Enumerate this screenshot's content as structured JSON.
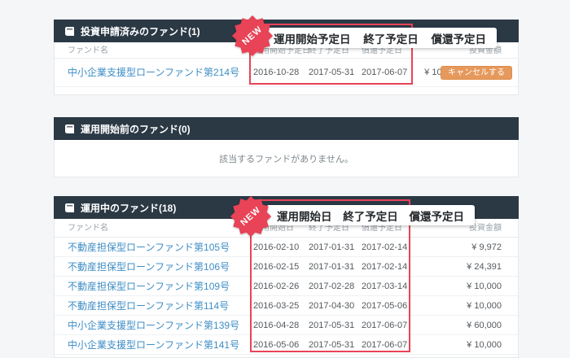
{
  "badge_label": "NEW",
  "colors": {
    "accent_red": "#e84356",
    "header_dark": "#2b3945",
    "link_blue": "#3e8dc5",
    "button_orange": "#e6995c",
    "page_background": "#f4f6f7"
  },
  "panel_applied": {
    "title": "投資申請済みのファンド(1)",
    "callout": {
      "c1": "運用開始予定日",
      "c2": "終了予定日",
      "c3": "償還予定日"
    },
    "columns": {
      "name": "ファンド名",
      "start": "運用開始予定日",
      "end": "終了予定日",
      "redemption": "償還予定日",
      "amount": "投資金額"
    },
    "row": {
      "name": "中小企業支援型ローンファンド第214号",
      "start": "2016-10-28",
      "end": "2017-05-31",
      "redemption": "2017-06-07",
      "amount": "¥ 10,000",
      "action": "キャンセルする"
    }
  },
  "panel_pre_operation": {
    "title": "運用開始前のファンド(0)",
    "empty_message": "該当するファンドがありません。"
  },
  "panel_operating": {
    "title": "運用中のファンド(18)",
    "callout": {
      "c1": "運用開始日",
      "c2": "終了予定日",
      "c3": "償還予定日"
    },
    "columns": {
      "name": "ファンド名",
      "start": "運用開始日",
      "end": "終了予定日",
      "redemption": "償還予定日",
      "amount": "投資金額"
    },
    "rows": [
      {
        "name": "不動産担保型ローンファンド第105号",
        "start": "2016-02-10",
        "end": "2017-01-31",
        "redemption": "2017-02-14",
        "amount": "¥ 9,972"
      },
      {
        "name": "不動産担保型ローンファンド第106号",
        "start": "2016-02-15",
        "end": "2017-01-31",
        "redemption": "2017-02-14",
        "amount": "¥ 24,391"
      },
      {
        "name": "不動産担保型ローンファンド第109号",
        "start": "2016-02-26",
        "end": "2017-02-28",
        "redemption": "2017-03-14",
        "amount": "¥ 10,000"
      },
      {
        "name": "不動産担保型ローンファンド第114号",
        "start": "2016-03-25",
        "end": "2017-04-30",
        "redemption": "2017-05-06",
        "amount": "¥ 10,000"
      },
      {
        "name": "中小企業支援型ローンファンド第139号",
        "start": "2016-04-28",
        "end": "2017-05-31",
        "redemption": "2017-06-07",
        "amount": "¥ 60,000"
      },
      {
        "name": "中小企業支援型ローンファンド第141号",
        "start": "2016-05-06",
        "end": "2017-05-31",
        "redemption": "2017-06-07",
        "amount": "¥ 10,000"
      }
    ]
  }
}
